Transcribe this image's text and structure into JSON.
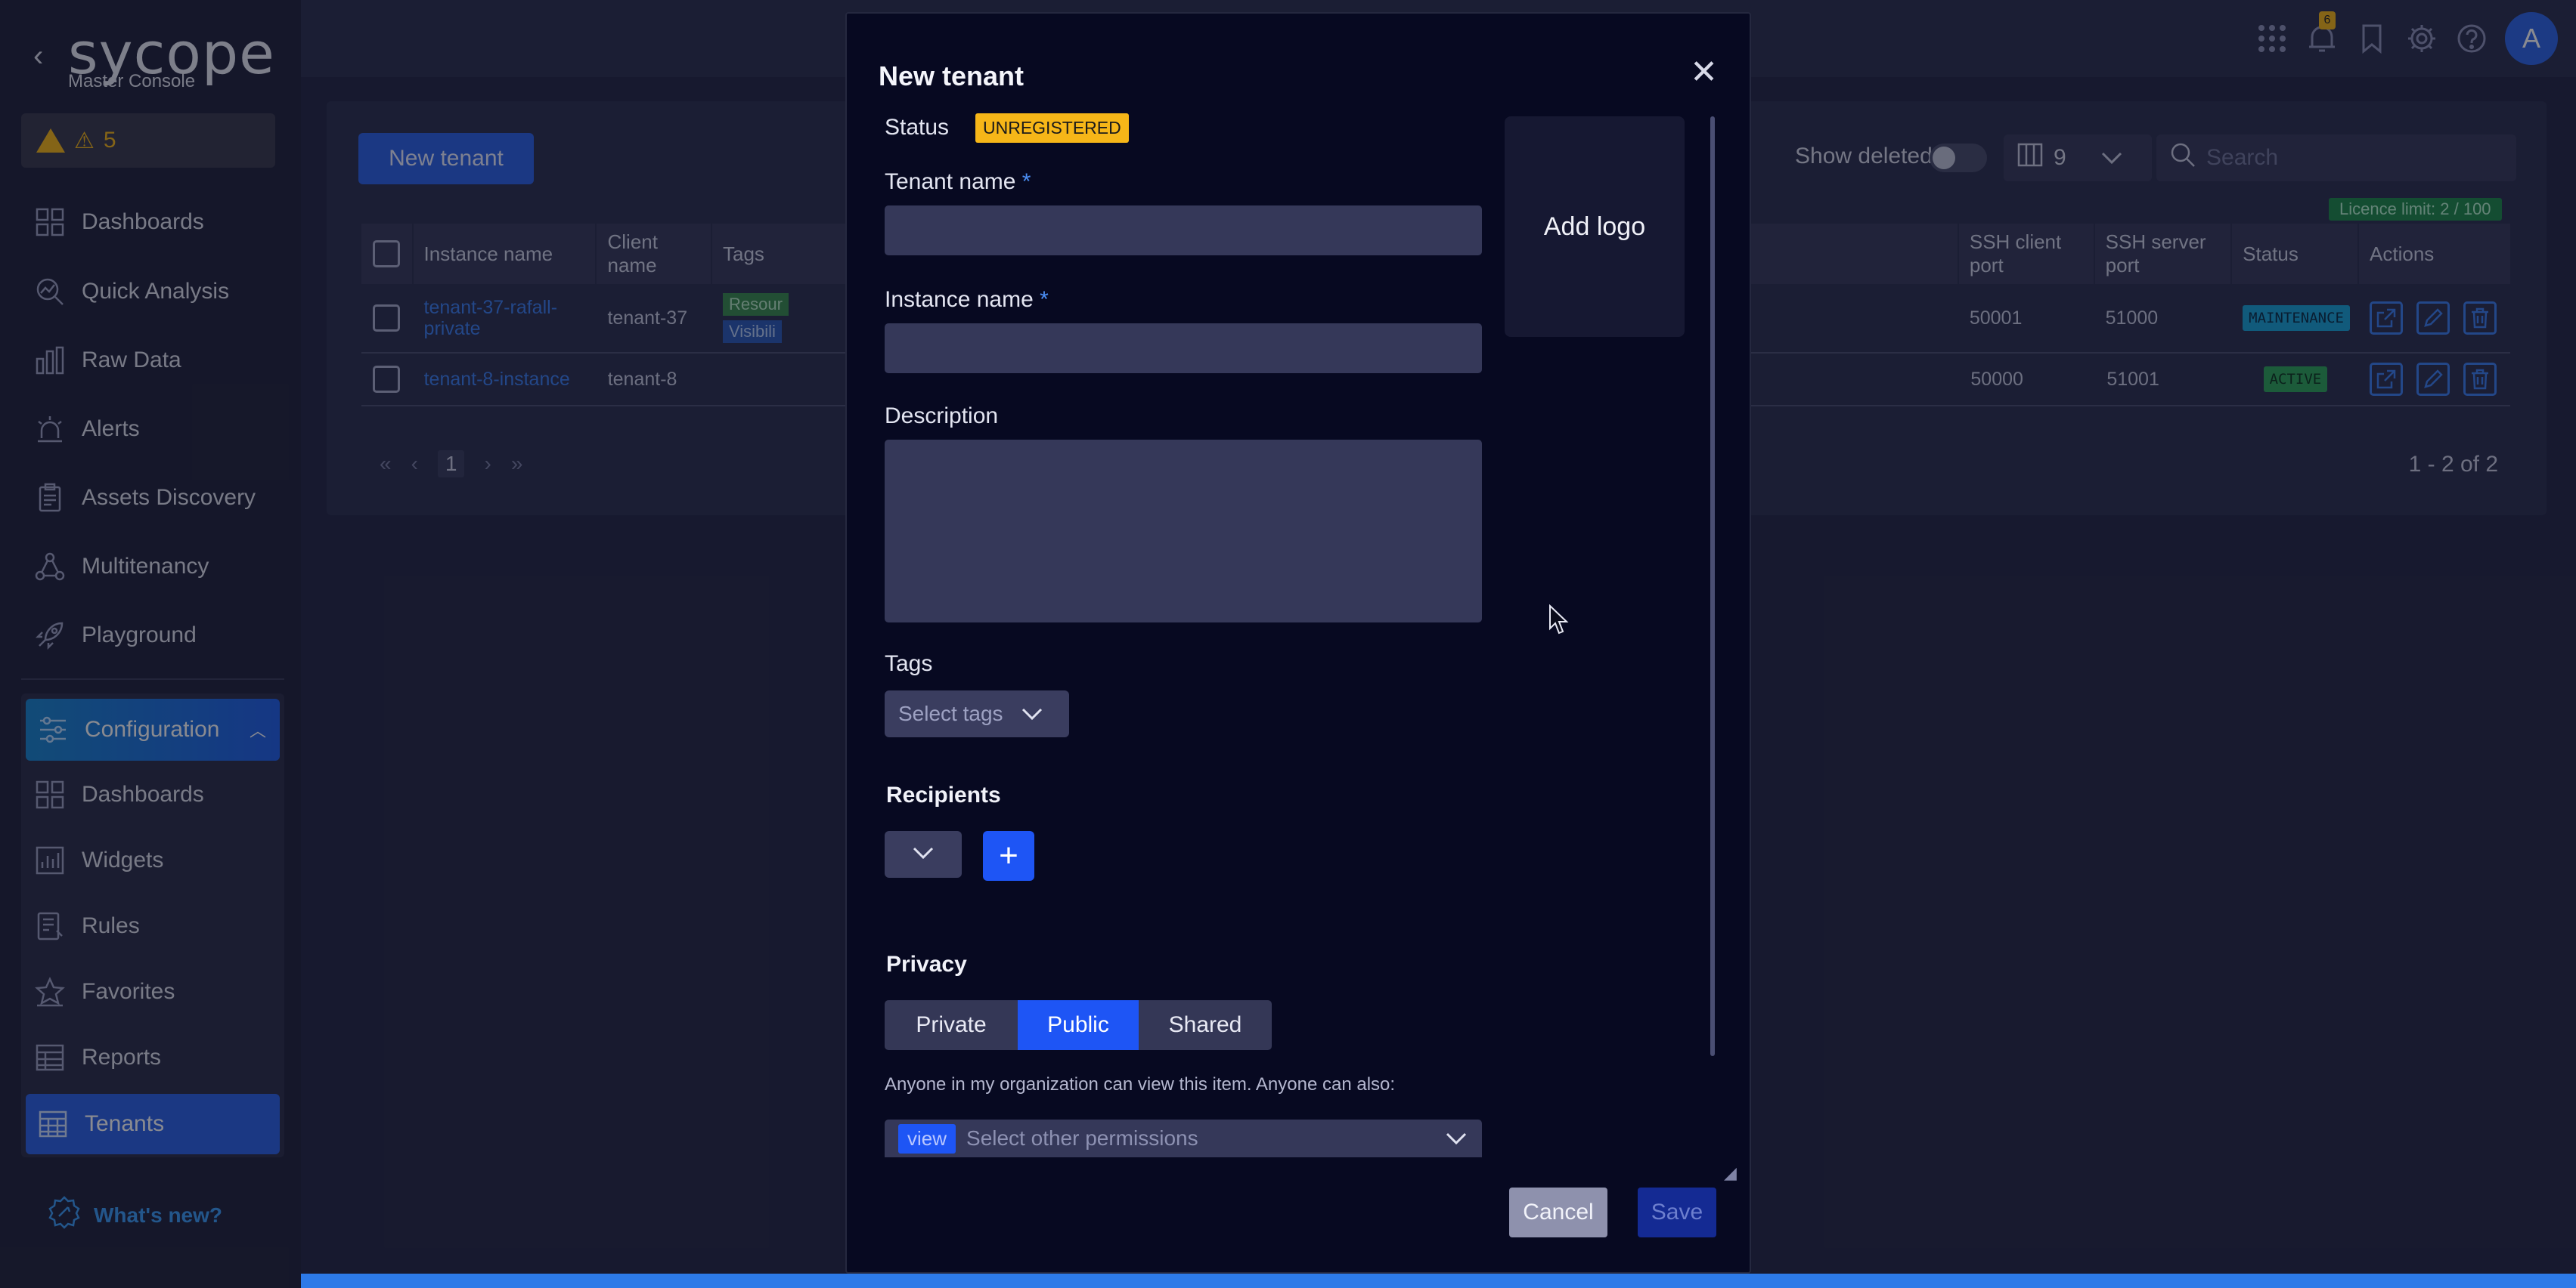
{
  "app": {
    "logo": "sycope",
    "logo_sub": "Master Console",
    "alert_count": "5",
    "alert_glyph": "⚠"
  },
  "sidebar": {
    "items": [
      {
        "label": "Dashboards",
        "icon": "dashboard-grid-icon"
      },
      {
        "label": "Quick Analysis",
        "icon": "chart-search-icon"
      },
      {
        "label": "Raw Data",
        "icon": "bar-chart-icon"
      },
      {
        "label": "Alerts",
        "icon": "siren-icon"
      },
      {
        "label": "Assets Discovery",
        "icon": "clipboard-icon"
      },
      {
        "label": "Multitenancy",
        "icon": "network-icon"
      },
      {
        "label": "Playground",
        "icon": "rocket-icon"
      }
    ],
    "config": {
      "label": "Configuration",
      "items": [
        {
          "label": "Dashboards",
          "icon": "dashboard-grid-icon"
        },
        {
          "label": "Widgets",
          "icon": "widget-chart-icon"
        },
        {
          "label": "Rules",
          "icon": "rules-icon"
        },
        {
          "label": "Favorites",
          "icon": "star-icon"
        },
        {
          "label": "Reports",
          "icon": "report-table-icon"
        },
        {
          "label": "Tenants",
          "icon": "tenants-table-icon",
          "active": true
        }
      ]
    },
    "whats_new": "What's new?"
  },
  "topbar": {
    "notification_count": "6",
    "avatar_initial": "A"
  },
  "list": {
    "new_button": "New tenant",
    "show_deleted": "Show deleted",
    "columns_count": "9",
    "search_placeholder": "Search",
    "licence": "Licence limit: 2 / 100",
    "headers": {
      "instance": "Instance name",
      "client": "Client name",
      "tags": "Tags",
      "ssh_client": "SSH client port",
      "ssh_server": "SSH server port",
      "status": "Status",
      "actions": "Actions"
    },
    "rows": [
      {
        "instance": "tenant-37-rafall-private",
        "client": "tenant-37",
        "tag1": "Resour",
        "tag2": "Visibili",
        "ssh_client": "50001",
        "ssh_server": "51000",
        "status": "MAINTENANCE"
      },
      {
        "instance": "tenant-8-instance",
        "client": "tenant-8",
        "ssh_client": "50000",
        "ssh_server": "51001",
        "status": "ACTIVE"
      }
    ],
    "page": "1",
    "range": "1 - 2 of 2"
  },
  "modal": {
    "title": "New tenant",
    "status_label": "Status",
    "status_value": "UNREGISTERED",
    "tenant_name_label": "Tenant name",
    "instance_name_label": "Instance name",
    "required_mark": "*",
    "description_label": "Description",
    "add_logo": "Add logo",
    "tags_label": "Tags",
    "tags_placeholder": "Select tags",
    "recipients_label": "Recipients",
    "privacy_label": "Privacy",
    "privacy_options": [
      "Private",
      "Public",
      "Shared"
    ],
    "privacy_selected": "Public",
    "privacy_note": "Anyone in my organization can view this item. Anyone can also:",
    "perm_tag": "view",
    "perm_placeholder": "Select other permissions",
    "cancel": "Cancel",
    "save": "Save"
  },
  "colors": {
    "accent": "#2d63e6",
    "warning": "#f6b618",
    "maintenance": "#1aa3d6",
    "active": "#2fa55a",
    "modal_bg": "#070921"
  }
}
